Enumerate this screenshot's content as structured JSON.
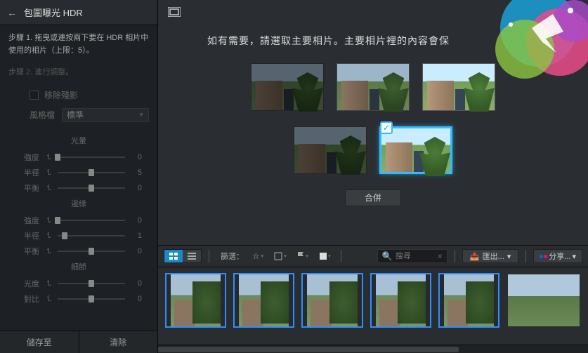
{
  "sidebar": {
    "title": "包圍曝光 HDR",
    "step1": "步驟 1. 拖曳或連按兩下要在 HDR 相片中使用的相片（上限：5）。",
    "step2": "步驟 2. 進行調整。",
    "remove_ghost": "移除殘影",
    "preset_label": "風格檔",
    "preset_value": "標準",
    "sections": {
      "glow": {
        "title": "光暈",
        "intensity": {
          "label": "強度",
          "value": 0,
          "pos": 0
        },
        "radius": {
          "label": "半徑",
          "value": 5,
          "pos": 50
        },
        "balance": {
          "label": "平衡",
          "value": 0,
          "pos": 50
        }
      },
      "edge": {
        "title": "邊緣",
        "intensity": {
          "label": "強度",
          "value": 0,
          "pos": 0
        },
        "radius": {
          "label": "半徑",
          "value": 1,
          "pos": 10
        },
        "balance": {
          "label": "平衡",
          "value": 0,
          "pos": 50
        }
      },
      "detail": {
        "title": "細節",
        "brightness": {
          "label": "光度",
          "value": 0,
          "pos": 50
        },
        "contrast": {
          "label": "對比",
          "value": 0,
          "pos": 50
        }
      }
    },
    "footer": {
      "save": "儲存至",
      "clear": "清除"
    }
  },
  "main": {
    "instruction": "如有需要，請選取主要相片。主要相片裡的內容會保",
    "merge": "合併"
  },
  "browser": {
    "filter_label": "篩選：",
    "search_placeholder": "搜尋",
    "export": "匯出...",
    "share": "分享..."
  }
}
